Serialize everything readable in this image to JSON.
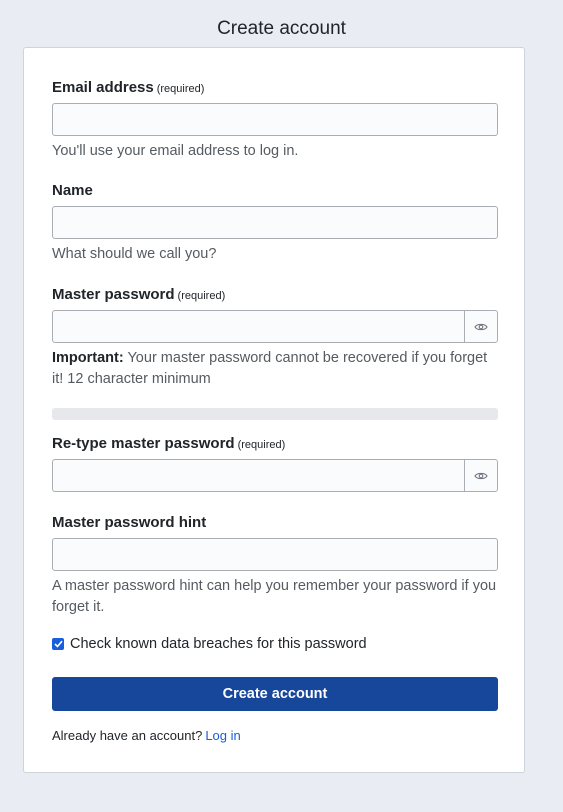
{
  "page": {
    "title": "Create account"
  },
  "form": {
    "email": {
      "label": "Email address",
      "required": "(required)",
      "value": "",
      "hint": "You'll use your email address to log in."
    },
    "name": {
      "label": "Name",
      "value": "",
      "hint": "What should we call you?"
    },
    "master_password": {
      "label": "Master password",
      "required": "(required)",
      "value": "",
      "hint_strong": "Important:",
      "hint": "Your master password cannot be recovered if you forget it! 12 character minimum",
      "toggle_icon": "eye-icon"
    },
    "strength_meter": {
      "level": 0
    },
    "retype_password": {
      "label": "Re-type master password",
      "required": "(required)",
      "value": "",
      "toggle_icon": "eye-icon"
    },
    "password_hint": {
      "label": "Master password hint",
      "value": "",
      "hint": "A master password hint can help you remember your password if you forget it."
    },
    "breach_check": {
      "label": "Check known data breaches for this password",
      "checked": true
    },
    "submit_label": "Create account",
    "login_prompt": "Already have an account?",
    "login_link": "Log in"
  },
  "colors": {
    "primary": "#17479a",
    "link": "#175ddc",
    "background": "#e9edf3"
  }
}
